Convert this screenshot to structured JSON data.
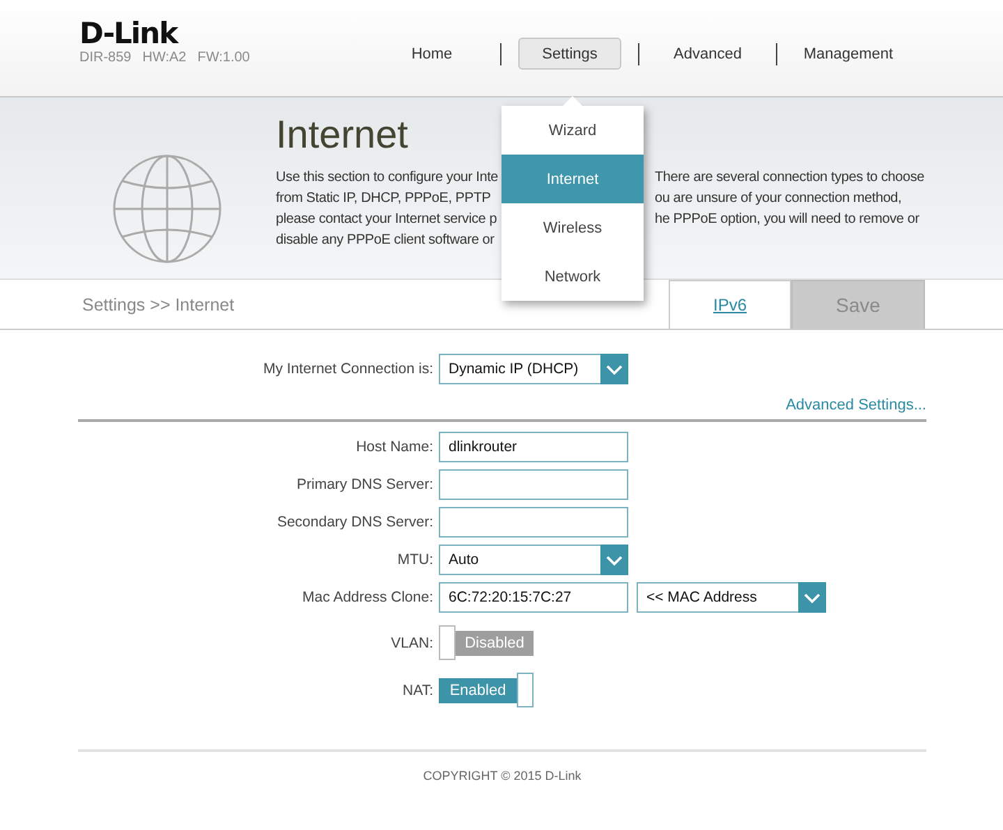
{
  "header": {
    "logo": "D-Link",
    "model_info": [
      "DIR-859",
      "HW:A2",
      "FW:1.00"
    ],
    "nav": [
      {
        "label": "Home",
        "selected": false
      },
      {
        "label": "Settings",
        "selected": true
      },
      {
        "label": "Advanced",
        "selected": false
      },
      {
        "label": "Management",
        "selected": false
      }
    ]
  },
  "settings_menu": [
    {
      "label": "Wizard",
      "selected": false
    },
    {
      "label": "Internet",
      "selected": true
    },
    {
      "label": "Wireless",
      "selected": false
    },
    {
      "label": "Network",
      "selected": false
    }
  ],
  "banner": {
    "title": "Internet",
    "description_lines": [
      {
        "left": "Use this section to configure your Inte",
        "right": "There are several connection types to choose"
      },
      {
        "left": "from Static IP, DHCP, PPPoE, PPTP",
        "right": "ou are unsure of your connection method,"
      },
      {
        "left": "please contact your Internet service p",
        "right": "he PPPoE option, you will need to remove or"
      },
      {
        "left": "disable any PPPoE client software or"
      }
    ]
  },
  "breadcrumb": "Settings >> Internet",
  "actions": [
    {
      "kind": "link",
      "label": "IPv6"
    },
    {
      "kind": "button",
      "label": "Save",
      "disabled": true
    }
  ],
  "form": {
    "connection": {
      "label": "My Internet Connection is:",
      "value": "Dynamic IP (DHCP)"
    },
    "advanced_link": "Advanced Settings...",
    "fields": [
      {
        "kind": "text",
        "label": "Host Name:",
        "value": "dlinkrouter"
      },
      {
        "kind": "text",
        "label": "Primary DNS Server:"
      },
      {
        "kind": "text",
        "label": "Secondary DNS Server:"
      },
      {
        "kind": "select",
        "label": "MTU:",
        "value": "Auto"
      },
      {
        "kind": "text_select",
        "label": "Mac Address Clone:",
        "value": "6C:72:20:15:7C:27",
        "select_value": "<< MAC Address"
      },
      {
        "kind": "toggle",
        "label": "VLAN:",
        "on": false,
        "state_text": "Disabled"
      },
      {
        "kind": "toggle",
        "label": "NAT:",
        "on": true,
        "state_text": "Enabled"
      }
    ]
  },
  "footer": "COPYRIGHT © 2015 D-Link"
}
